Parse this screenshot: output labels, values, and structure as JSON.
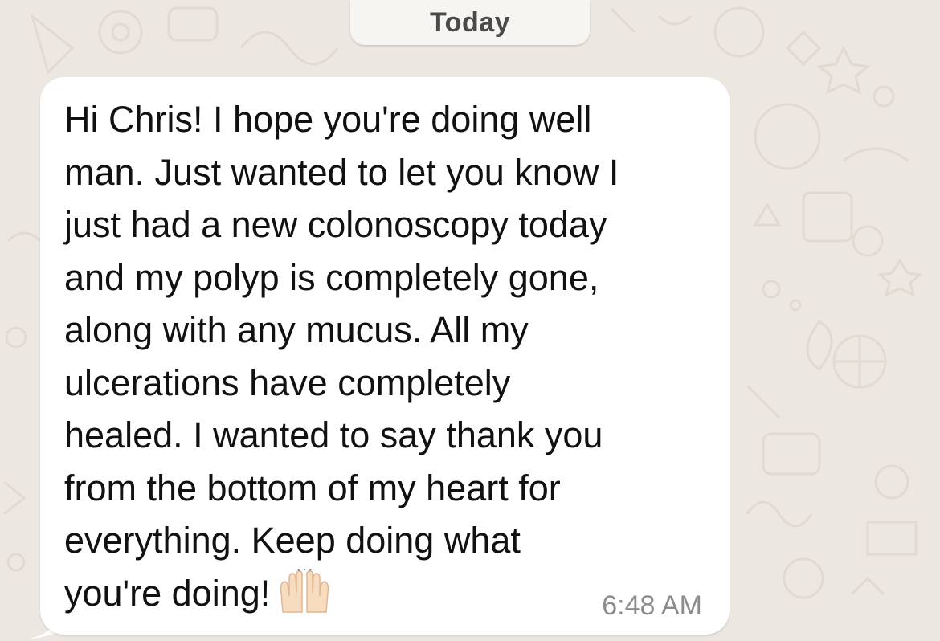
{
  "chat": {
    "date_label": "Today",
    "message": {
      "text": "Hi Chris! I hope you're doing well\nman. Just wanted to let you know I\njust had a new colonoscopy today\nand my polyp is completely gone,\nalong with any mucus. All my\nulcerations have completely\nhealed. I wanted to say thank you\nfrom the bottom of my heart for\neverything. Keep doing what\nyou're doing!",
      "emoji": "raising-hands-icon",
      "time": "6:48 AM"
    }
  },
  "colors": {
    "wallpaper": "#ece7e0",
    "bubble": "#ffffff",
    "date_chip": "#f7f5f1",
    "timestamp": "#8c8c8c"
  }
}
